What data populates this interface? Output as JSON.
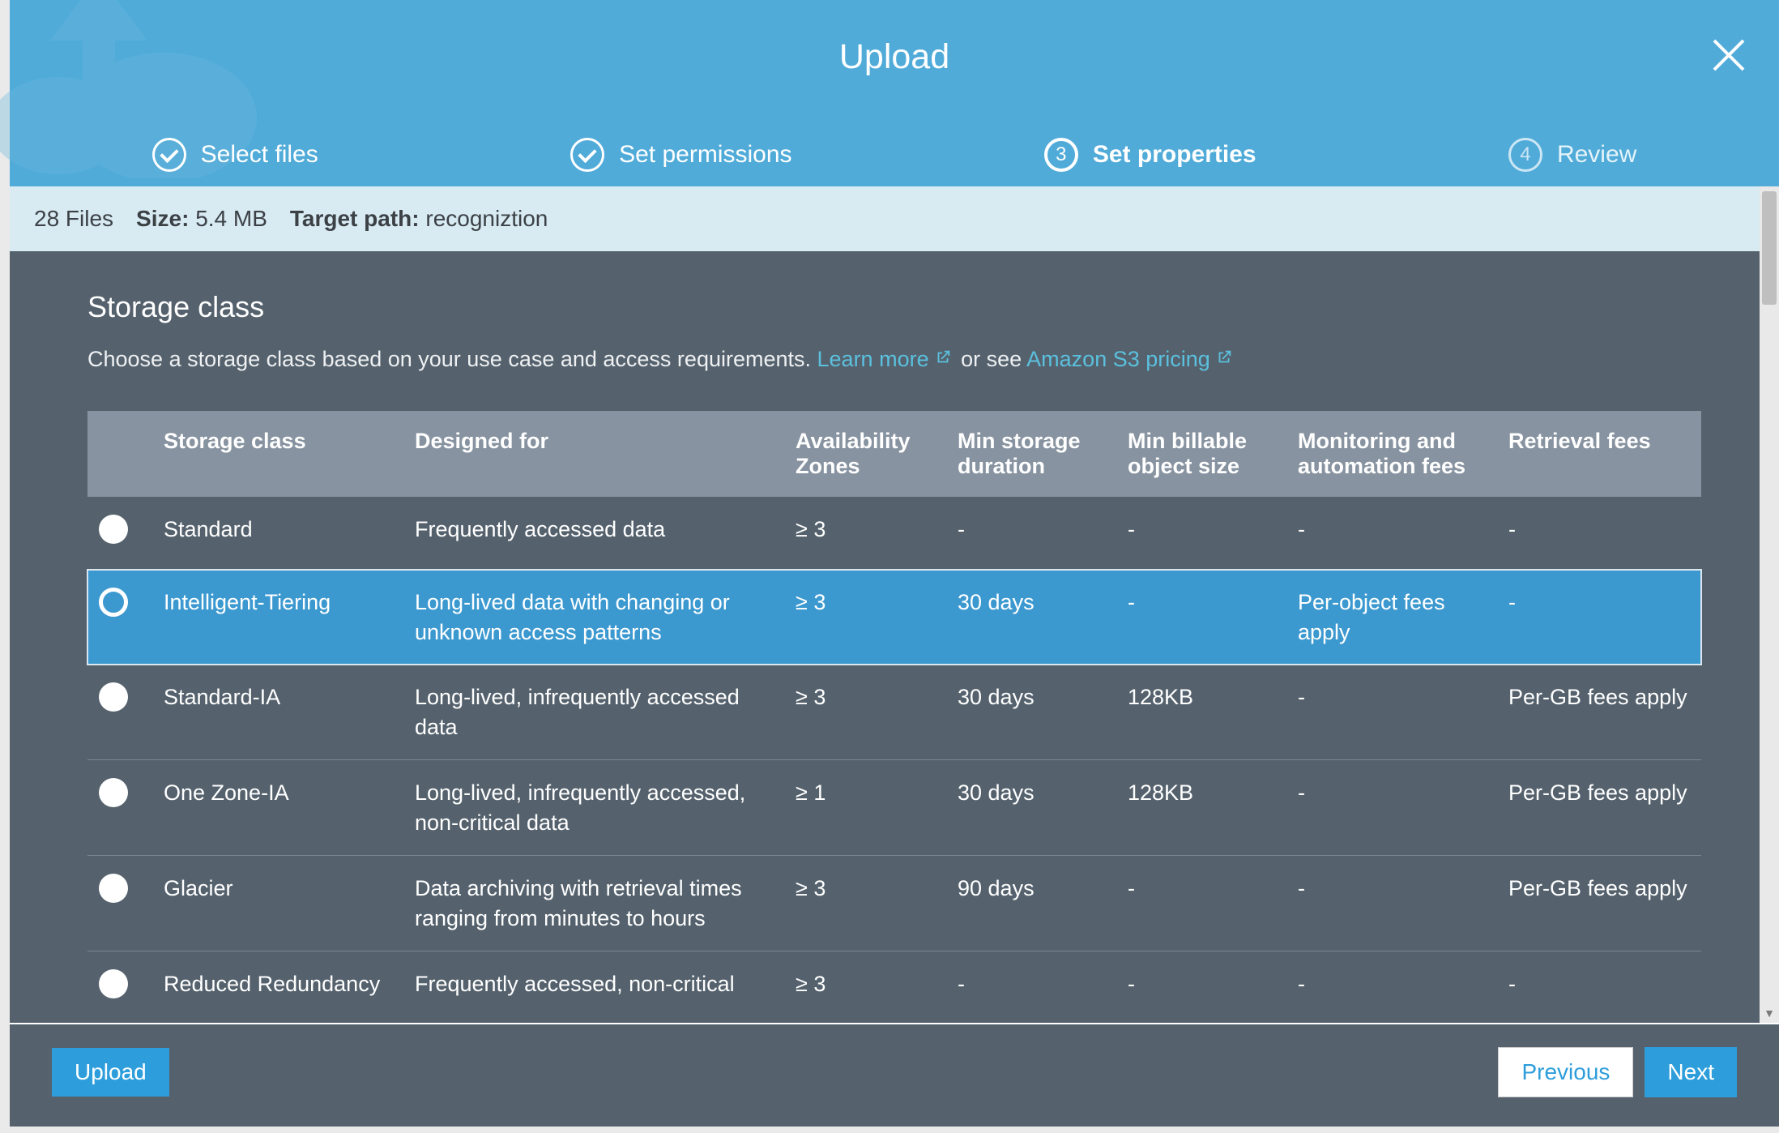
{
  "header": {
    "title": "Upload",
    "steps": [
      {
        "label": "Select files",
        "state": "done"
      },
      {
        "label": "Set permissions",
        "state": "done"
      },
      {
        "label": "Set properties",
        "state": "active",
        "num": "3"
      },
      {
        "label": "Review",
        "state": "pending",
        "num": "4"
      }
    ]
  },
  "info": {
    "files_label": "28 Files",
    "size_label": "Size:",
    "size_value": "5.4 MB",
    "target_label": "Target path:",
    "target_value": "recogniztion"
  },
  "section": {
    "title": "Storage class",
    "desc_pre": "Choose a storage class based on your use case and access requirements. ",
    "learn_more": "Learn more",
    "desc_mid": " or see ",
    "pricing": "Amazon S3 pricing"
  },
  "table": {
    "headers": {
      "class": "Storage class",
      "designed": "Designed for",
      "az": "Availability Zones",
      "duration": "Min storage duration",
      "size": "Min billable object size",
      "monitoring": "Monitoring and automation fees",
      "retrieval": "Retrieval fees"
    },
    "rows": [
      {
        "class": "Standard",
        "designed": "Frequently accessed data",
        "az": "≥ 3",
        "duration": "-",
        "size": "-",
        "monitoring": "-",
        "retrieval": "-",
        "selected": false
      },
      {
        "class": "Intelligent-Tiering",
        "designed": "Long-lived data with changing or unknown access patterns",
        "az": "≥ 3",
        "duration": "30 days",
        "size": "-",
        "monitoring": "Per-object fees apply",
        "retrieval": "-",
        "selected": true
      },
      {
        "class": "Standard-IA",
        "designed": "Long-lived, infrequently accessed data",
        "az": "≥ 3",
        "duration": "30 days",
        "size": "128KB",
        "monitoring": "-",
        "retrieval": "Per-GB fees apply",
        "selected": false
      },
      {
        "class": "One Zone-IA",
        "designed": "Long-lived, infrequently accessed, non-critical data",
        "az": "≥ 1",
        "duration": "30 days",
        "size": "128KB",
        "monitoring": "-",
        "retrieval": "Per-GB fees apply",
        "selected": false
      },
      {
        "class": "Glacier",
        "designed": "Data archiving with retrieval times ranging from minutes to hours",
        "az": "≥ 3",
        "duration": "90 days",
        "size": "-",
        "monitoring": "-",
        "retrieval": "Per-GB fees apply",
        "selected": false
      },
      {
        "class": "Reduced Redundancy",
        "designed": "Frequently accessed, non-critical",
        "az": "≥ 3",
        "duration": "-",
        "size": "-",
        "monitoring": "-",
        "retrieval": "-",
        "selected": false
      }
    ]
  },
  "footer": {
    "upload": "Upload",
    "previous": "Previous",
    "next": "Next"
  }
}
